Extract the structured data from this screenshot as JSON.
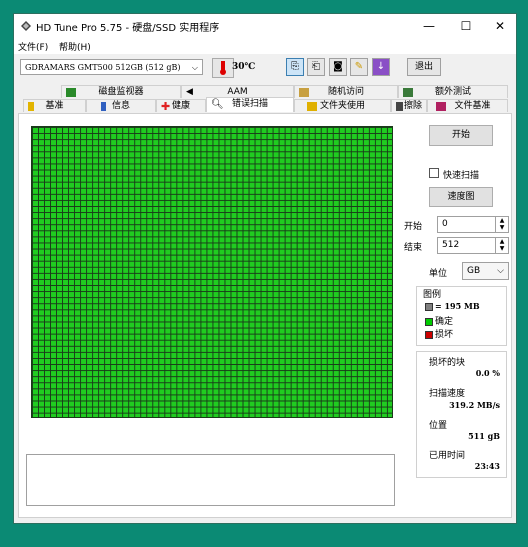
{
  "window": {
    "title": "HD Tune Pro 5.75 - 硬盘/SSD 实用程序"
  },
  "window_controls": {
    "minimize": "—",
    "maximize": "☐",
    "close": "✕"
  },
  "menu": {
    "file": "文件(F)",
    "help": "帮助(H)"
  },
  "toolbar": {
    "drive": "GDRAMARS GMT500 512GB (512 gB)",
    "temperature": "30",
    "temp_unit": "℃",
    "exit_label": "退出"
  },
  "tabs_top": [
    {
      "label": "磁盘监视器"
    },
    {
      "label": "AAM"
    },
    {
      "label": "随机访问"
    },
    {
      "label": "额外测试"
    }
  ],
  "tabs_bottom": [
    {
      "label": "基准"
    },
    {
      "label": "信息"
    },
    {
      "label": "健康"
    },
    {
      "label": "错误扫描"
    },
    {
      "label": "文件夹使用"
    },
    {
      "label": "擦除"
    },
    {
      "label": "文件基准"
    }
  ],
  "active_tab": "错误扫描",
  "controls": {
    "start_button": "开始",
    "quick_scan_label": "快速扫描",
    "quick_scan_checked": false,
    "speed_map_button": "速度图",
    "start_label": "开始",
    "start_value": "0",
    "end_label": "结束",
    "end_value": "512",
    "unit_label": "单位",
    "unit_value": "GB"
  },
  "legend": {
    "title": "图例",
    "block_text": "= 195 MB",
    "ok_label": "确定",
    "bad_label": "损坏",
    "ok_color": "#00cc00",
    "bad_color": "#cc0000",
    "block_color": "#808080"
  },
  "stats": {
    "damaged_label": "损坏的块",
    "damaged_value": "0.0 %",
    "speed_label": "扫描速度",
    "speed_value": "319.2 MB/s",
    "position_label": "位置",
    "position_value": "511 gB",
    "elapsed_label": "已用时间",
    "elapsed_value": "23:43"
  },
  "scan_grid": {
    "cells_ok_fraction": 1.0,
    "color": "#20cc20"
  }
}
